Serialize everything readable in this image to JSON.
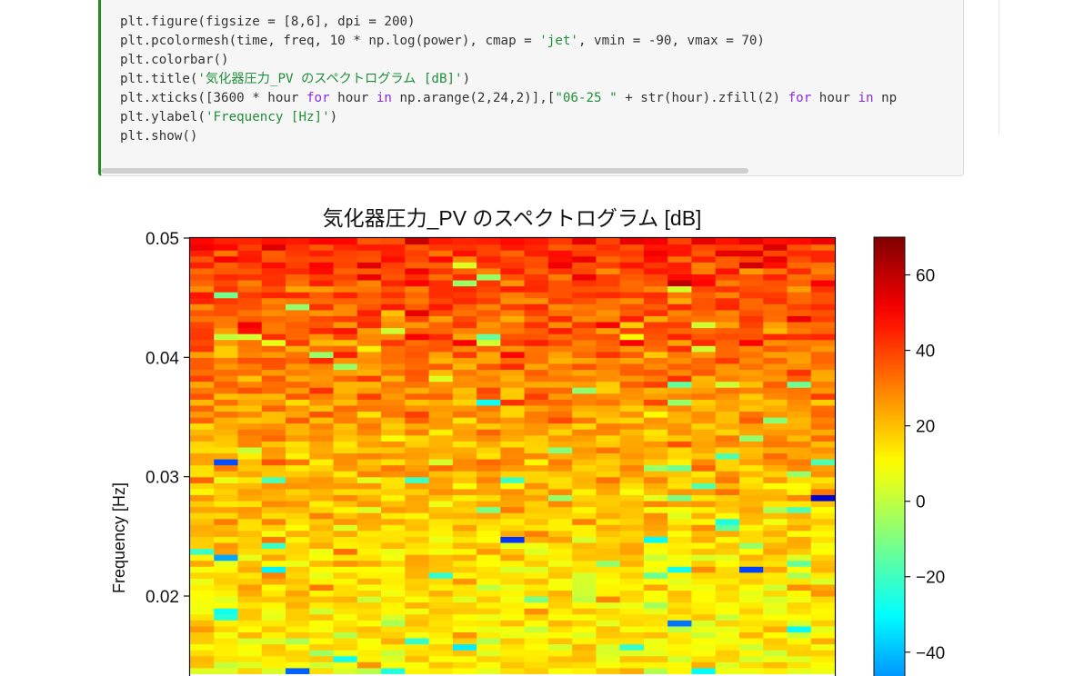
{
  "code_cell": {
    "lines": [
      [
        {
          "t": "plt.figure(figsize = [8,6], dpi = 200)",
          "c": ""
        }
      ],
      [
        {
          "t": "plt.pcolormesh(time, freq, 10 * np.log(power), cmap = ",
          "c": ""
        },
        {
          "t": "'jet'",
          "c": "s"
        },
        {
          "t": ", vmin = -90, vmax = 70)",
          "c": ""
        }
      ],
      [
        {
          "t": "plt.colorbar()",
          "c": ""
        }
      ],
      [
        {
          "t": "plt.title(",
          "c": ""
        },
        {
          "t": "'気化器圧力_PV のスペクトログラム [dB]'",
          "c": "s"
        },
        {
          "t": ")",
          "c": ""
        }
      ],
      [
        {
          "t": "plt.xticks([3600 * hour ",
          "c": ""
        },
        {
          "t": "for",
          "c": "k"
        },
        {
          "t": " hour ",
          "c": ""
        },
        {
          "t": "in",
          "c": "k"
        },
        {
          "t": " np.arange(2,24,2)],[",
          "c": ""
        },
        {
          "t": "\"06-25 \"",
          "c": "s"
        },
        {
          "t": " + str(hour).zfill(2) ",
          "c": ""
        },
        {
          "t": "for",
          "c": "k"
        },
        {
          "t": " hour ",
          "c": ""
        },
        {
          "t": "in",
          "c": "k"
        },
        {
          "t": " np",
          "c": ""
        }
      ],
      [
        {
          "t": "plt.ylabel(",
          "c": ""
        },
        {
          "t": "'Frequency [Hz]'",
          "c": "s"
        },
        {
          "t": ")",
          "c": ""
        }
      ],
      [
        {
          "t": "plt.show()",
          "c": ""
        }
      ]
    ]
  },
  "chart_data": {
    "type": "heatmap",
    "title": "気化器圧力_PV のスペクトログラム [dB]",
    "xlabel": "",
    "ylabel": "Frequency [Hz]",
    "colormap": "jet",
    "vmin": -90,
    "vmax": 70,
    "ylim_visible": [
      0.0135,
      0.05
    ],
    "y_ticks": [
      0.05,
      0.04,
      0.03,
      0.02
    ],
    "y_tick_labels": [
      "0.05",
      "0.04",
      "0.03",
      "0.02"
    ],
    "colorbar_ticks": [
      60,
      40,
      20,
      0,
      -20,
      -40
    ],
    "colorbar_tick_labels": [
      "60",
      "40",
      "20",
      "0",
      "−20",
      "−40"
    ],
    "colorbar_visible_range": [
      -48,
      70
    ],
    "time_bins": 27,
    "freq_bins_visible": 73,
    "value_trend": {
      "low_freq_mean": 12,
      "high_freq_mean": 44,
      "noise_amplitude": 12
    },
    "notable_low_cells": [
      {
        "time_bin": 1,
        "freq": 0.0311,
        "value": -58
      },
      {
        "time_bin": 1,
        "freq": 0.0231,
        "value": -44
      },
      {
        "time_bin": 26,
        "freq": 0.0281,
        "value": -78
      },
      {
        "time_bin": 13,
        "freq": 0.0246,
        "value": -62
      },
      {
        "time_bin": 23,
        "freq": 0.0221,
        "value": -60
      },
      {
        "time_bin": 20,
        "freq": 0.0176,
        "value": -52
      },
      {
        "time_bin": 4,
        "freq": 0.0136,
        "value": -55
      },
      {
        "time_bin": 12,
        "freq": 0.0361,
        "value": -28
      },
      {
        "time_bin": 13,
        "freq": 0.0501,
        "value": -40
      }
    ]
  }
}
